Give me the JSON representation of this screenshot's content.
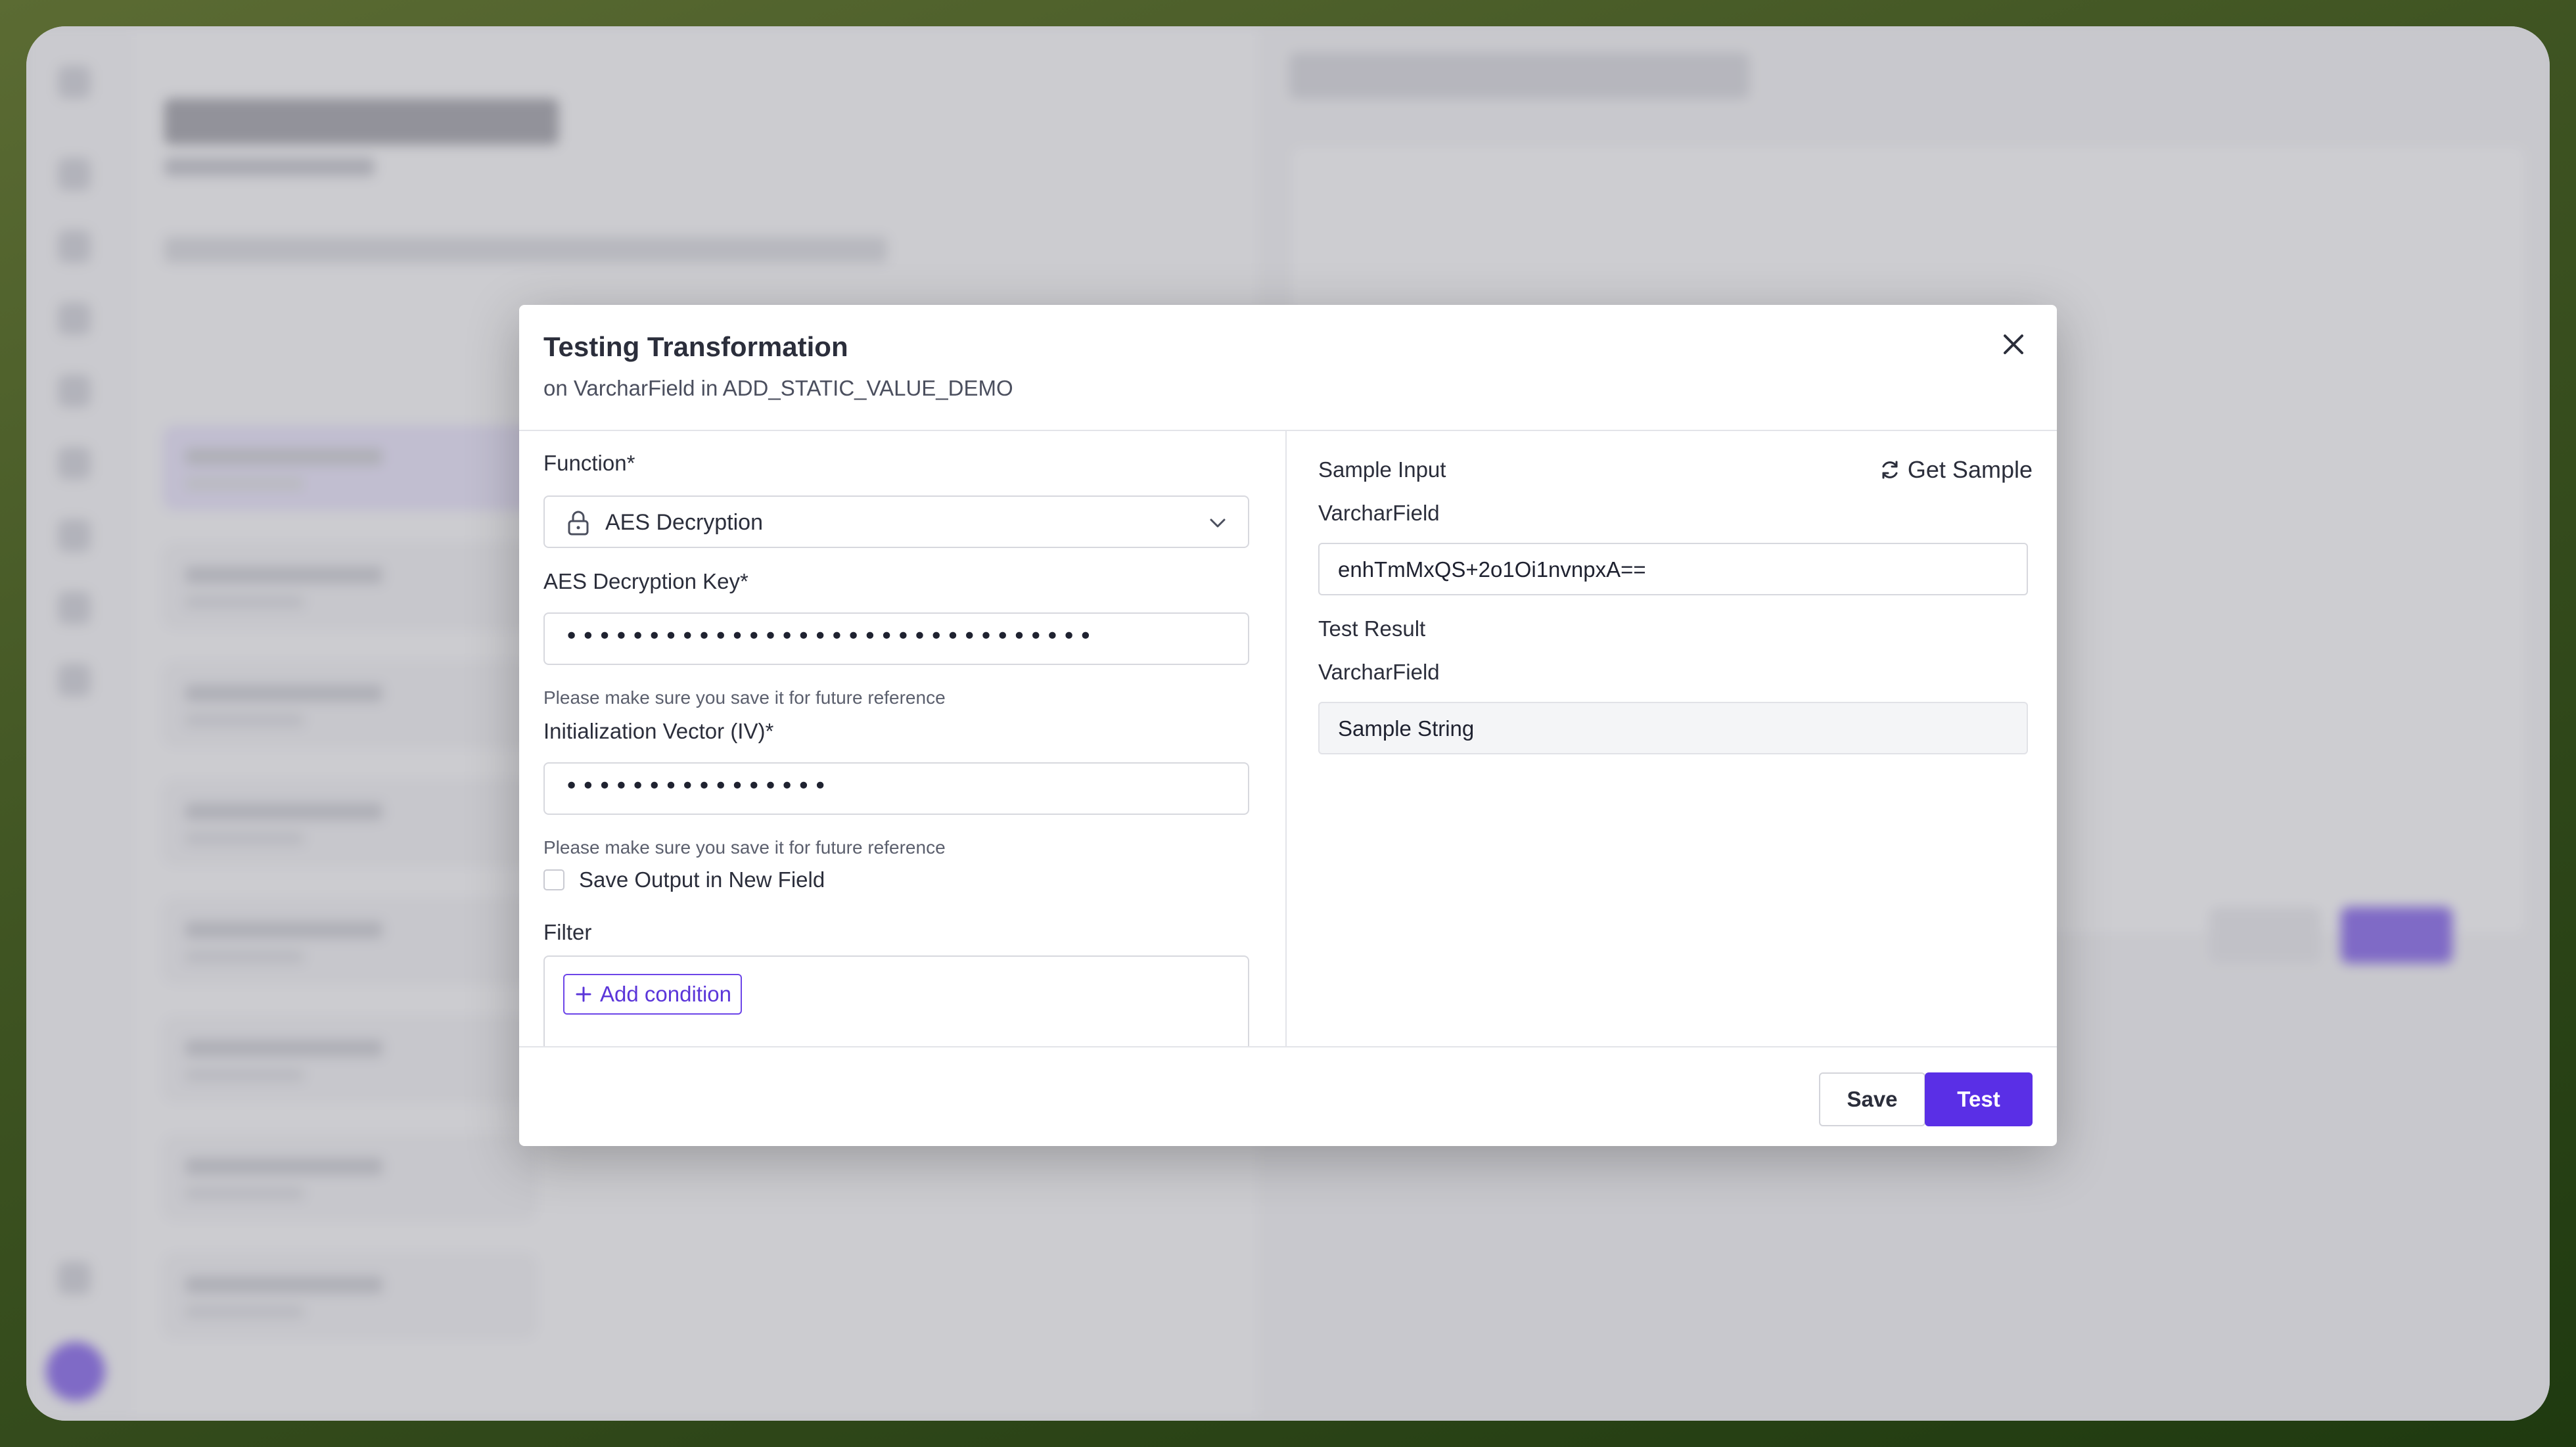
{
  "modal": {
    "title": "Testing Transformation",
    "subtitle": "on VarcharField in ADD_STATIC_VALUE_DEMO"
  },
  "form": {
    "function_label": "Function*",
    "function_value": "AES Decryption",
    "function_icon": "lock-icon",
    "key_label": "AES Decryption Key*",
    "key_value_masked": "••••••••••••••••••••••••••••••••",
    "key_helper": "Please make sure you save it for future reference",
    "iv_label": "Initialization Vector (IV)*",
    "iv_value_masked": "••••••••••••••••",
    "iv_helper": "Please make sure you save it for future reference",
    "save_output_label": "Save Output in New Field",
    "save_output_checked": false,
    "filter_label": "Filter",
    "add_condition_label": "Add condition"
  },
  "sample": {
    "title": "Sample Input",
    "get_sample_label": "Get Sample",
    "input_field_name": "VarcharField",
    "input_value": "enhTmMxQS+2o1Oi1nvnpxA==",
    "result_title": "Test Result",
    "result_field_name": "VarcharField",
    "result_value": "Sample String"
  },
  "footer": {
    "save_label": "Save",
    "test_label": "Test"
  },
  "colors": {
    "accent": "#5a2fe6",
    "accent_text": "#5b36d9",
    "border": "#d7d8de"
  }
}
